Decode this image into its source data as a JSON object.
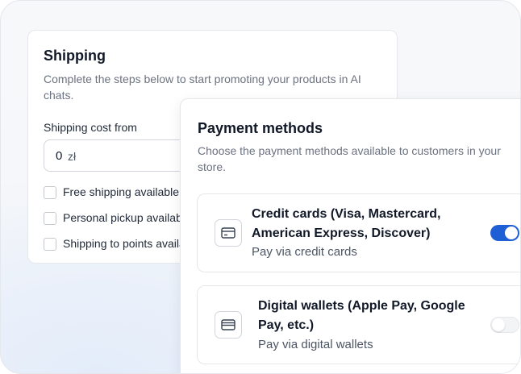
{
  "shipping": {
    "title": "Shipping",
    "description": "Complete the steps below to start promoting your products in AI chats.",
    "cost_label": "Shipping cost from",
    "cost_value": "0",
    "currency": "zł",
    "options": [
      {
        "label": "Free shipping available",
        "checked": false
      },
      {
        "label": "Personal pickup available",
        "checked": false
      },
      {
        "label": "Shipping to points available",
        "checked": false
      }
    ]
  },
  "payment": {
    "title": "Payment methods",
    "description": "Choose the payment methods available to customers in your store.",
    "methods": [
      {
        "title": "Credit cards (Visa, Mastercard, American Express, Discover)",
        "subtitle": "Pay via credit cards",
        "icon": "credit-card-icon",
        "enabled": true
      },
      {
        "title": "Digital wallets (Apple Pay, Google Pay, etc.)",
        "subtitle": "Pay via digital wallets",
        "icon": "wallet-icon",
        "enabled": false
      }
    ]
  },
  "colors": {
    "accent": "#1f5fd6"
  }
}
